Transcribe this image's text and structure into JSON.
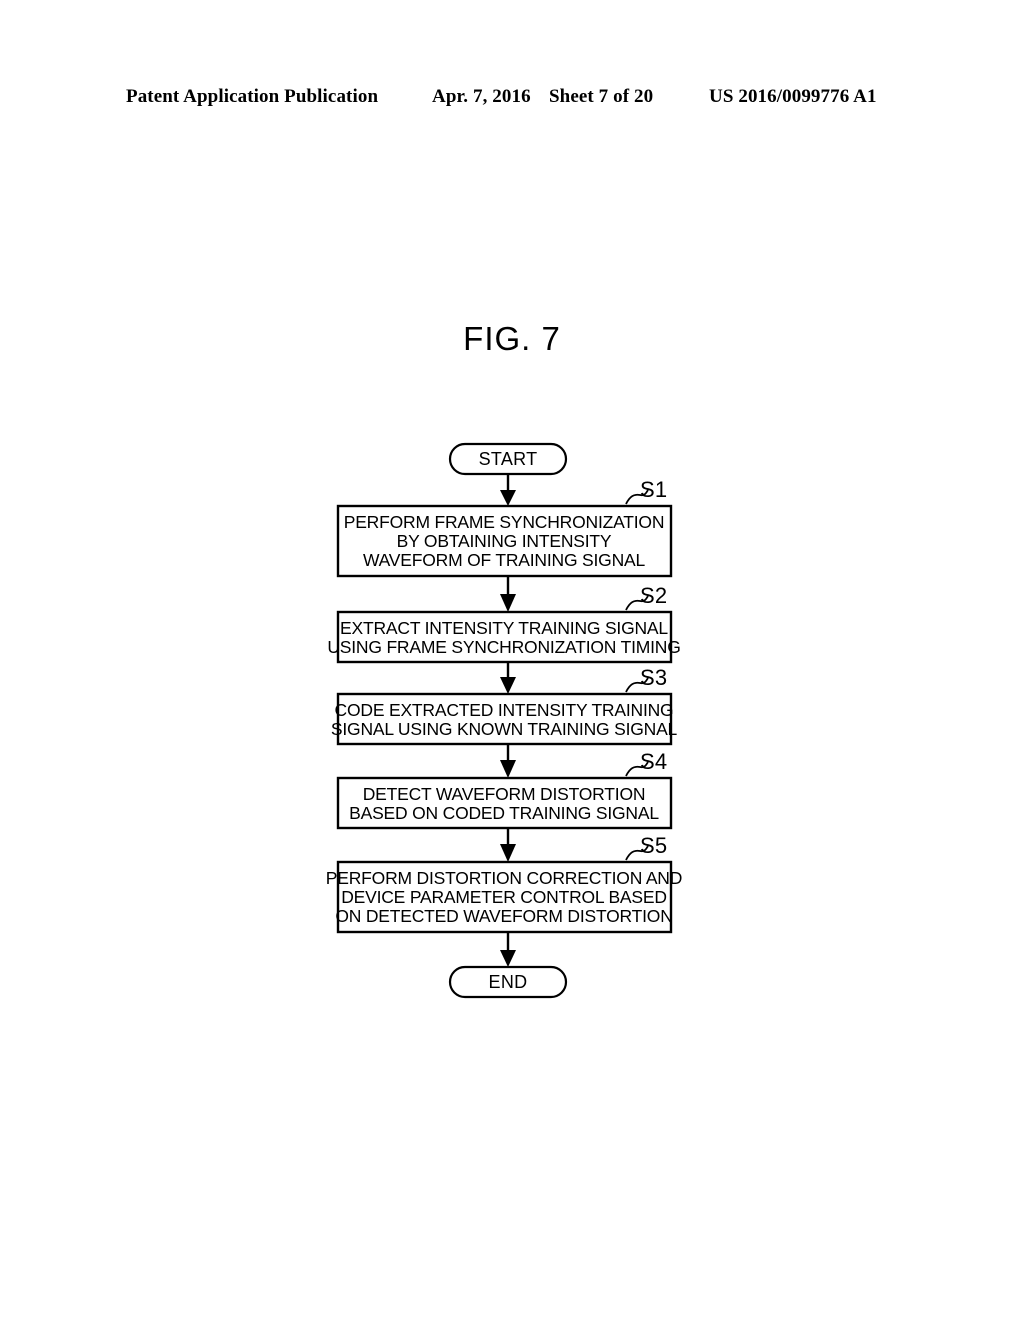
{
  "header": {
    "publication": "Patent Application Publication",
    "date": "Apr. 7, 2016",
    "sheet": "Sheet 7 of 20",
    "doc_number": "US 2016/0099776 A1"
  },
  "figure": {
    "title": "FIG. 7"
  },
  "flowchart": {
    "start_label": "START",
    "end_label": "END",
    "steps": [
      {
        "id": "S1",
        "lines": [
          "PERFORM FRAME SYNCHRONIZATION",
          "BY OBTAINING INTENSITY",
          "WAVEFORM OF TRAINING SIGNAL"
        ]
      },
      {
        "id": "S2",
        "lines": [
          "EXTRACT INTENSITY TRAINING SIGNAL",
          "USING FRAME SYNCHRONIZATION TIMING"
        ]
      },
      {
        "id": "S3",
        "lines": [
          "CODE EXTRACTED INTENSITY TRAINING",
          "SIGNAL USING KNOWN TRAINING SIGNAL"
        ]
      },
      {
        "id": "S4",
        "lines": [
          "DETECT WAVEFORM DISTORTION",
          "BASED ON CODED TRAINING SIGNAL"
        ]
      },
      {
        "id": "S5",
        "lines": [
          "PERFORM DISTORTION CORRECTION AND",
          "DEVICE PARAMETER CONTROL BASED",
          "ON DETECTED WAVEFORM DISTORTION"
        ]
      }
    ]
  },
  "colors": {
    "ink": "#000000",
    "paper": "#ffffff"
  }
}
